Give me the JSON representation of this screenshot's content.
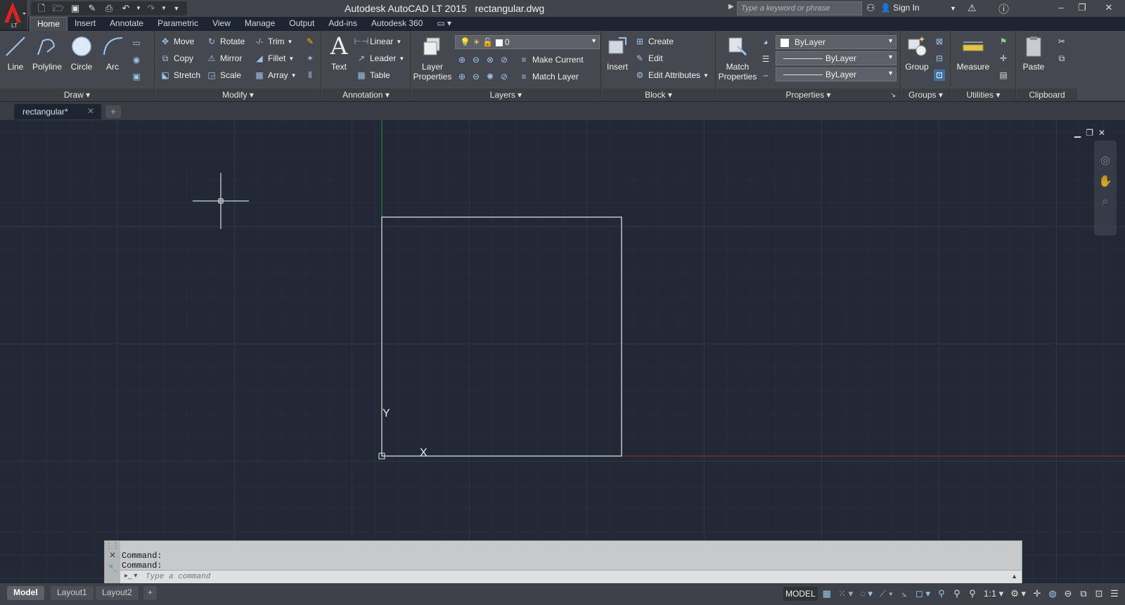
{
  "app": {
    "title": "Autodesk AutoCAD LT 2015",
    "file": "rectangular.dwg",
    "logo_sub": "LT",
    "search_placeholder": "Type a keyword or phrase",
    "sign_in": "Sign In"
  },
  "ribbon_tabs": [
    "Home",
    "Insert",
    "Annotate",
    "Parametric",
    "View",
    "Manage",
    "Output",
    "Add-ins",
    "Autodesk 360"
  ],
  "panels": {
    "draw": {
      "title": "Draw",
      "line": "Line",
      "polyline": "Polyline",
      "circle": "Circle",
      "arc": "Arc"
    },
    "modify": {
      "title": "Modify",
      "move": "Move",
      "rotate": "Rotate",
      "trim": "Trim",
      "copy": "Copy",
      "mirror": "Mirror",
      "fillet": "Fillet",
      "stretch": "Stretch",
      "scale": "Scale",
      "array": "Array"
    },
    "annotation": {
      "title": "Annotation",
      "text": "Text",
      "linear": "Linear",
      "leader": "Leader",
      "table": "Table"
    },
    "layers": {
      "title": "Layers",
      "layer_properties_1": "Layer",
      "layer_properties_2": "Properties",
      "current_layer": "0",
      "make_current": "Make Current",
      "match_layer": "Match Layer"
    },
    "block": {
      "title": "Block",
      "insert": "Insert",
      "create": "Create",
      "edit": "Edit",
      "edit_attributes": "Edit Attributes"
    },
    "properties": {
      "title": "Properties",
      "match_1": "Match",
      "match_2": "Properties",
      "color": "ByLayer",
      "lineweight": "ByLayer",
      "linetype": "ByLayer"
    },
    "groups": {
      "title": "Groups",
      "group": "Group"
    },
    "utilities": {
      "title": "Utilities",
      "measure": "Measure"
    },
    "clipboard": {
      "title": "Clipboard",
      "paste": "Paste"
    }
  },
  "document": {
    "tab": "rectangular*"
  },
  "ucs": {
    "x_label": "X",
    "y_label": "Y"
  },
  "command": {
    "history": [
      "Command:",
      "Command:"
    ],
    "placeholder": "Type a command"
  },
  "layouts": [
    "Model",
    "Layout1",
    "Layout2"
  ],
  "status": {
    "model": "MODEL",
    "scale": "1:1"
  },
  "colors": {
    "canvas": "#212836",
    "x_axis": "#b3262b",
    "y_axis": "#2e8b3a",
    "ribbon": "#45484e",
    "accent": "#9cc6f0"
  }
}
